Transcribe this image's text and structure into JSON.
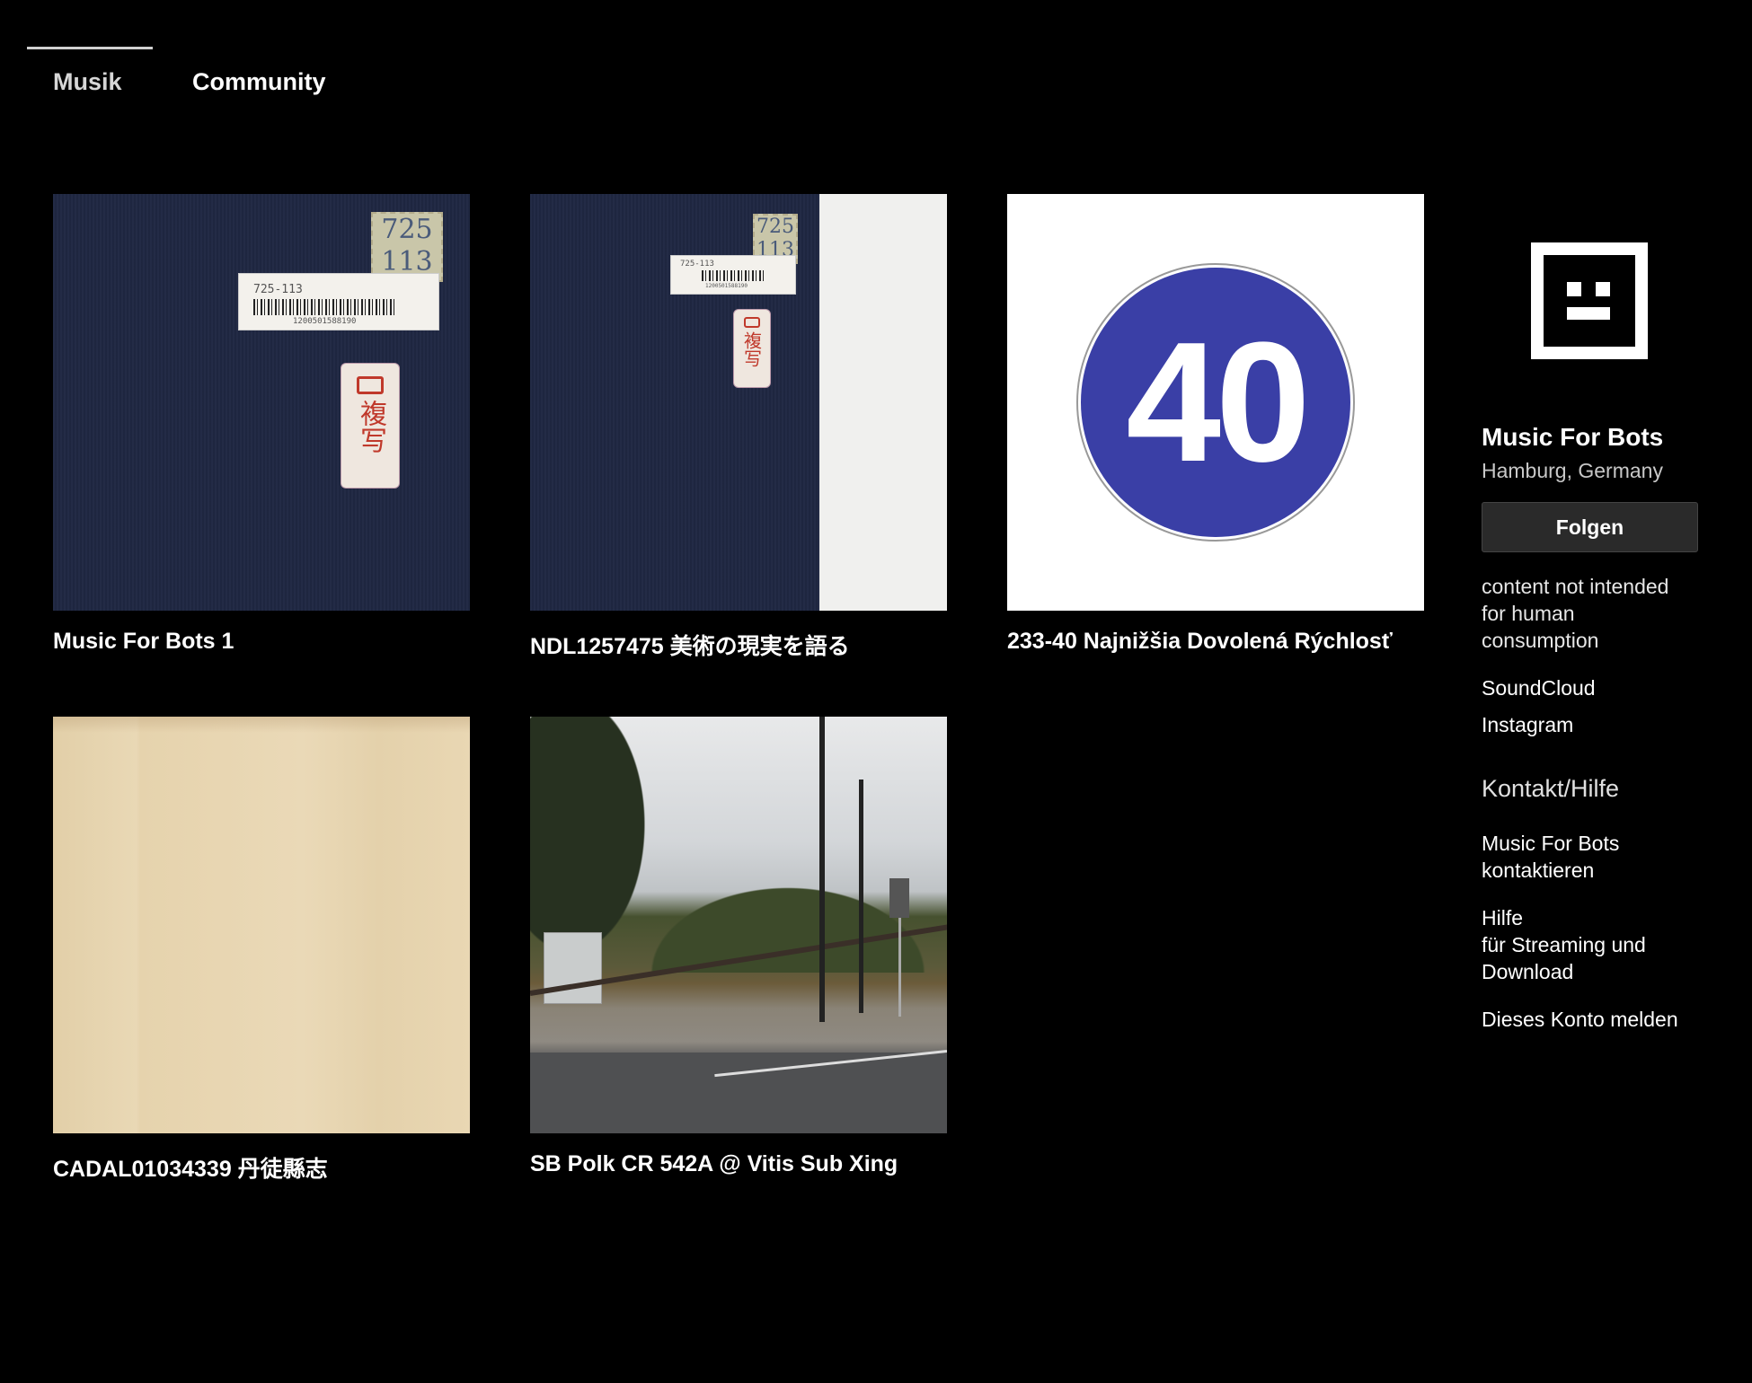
{
  "tabs": [
    {
      "label": "Musik",
      "active": true
    },
    {
      "label": "Community",
      "active": false
    }
  ],
  "releases": [
    {
      "title": "Music For Bots 1",
      "cover": "dark-blue-book-cover",
      "cover_text": {
        "stamp": "725\n113",
        "barcode_label": "725-113",
        "barcode_number": "1200501588190",
        "tag": "複写"
      }
    },
    {
      "title": "NDL1257475 美術の現実を語る",
      "cover": "dark-blue-book-with-page",
      "cover_text": {
        "stamp": "725\n113",
        "barcode_label": "725-113",
        "barcode_number": "1200501588190",
        "tag": "複写"
      }
    },
    {
      "title": "233-40 Najnižšia Dovolená Rýchlosť",
      "cover": "blue-speed-sign",
      "cover_text": {
        "sign": "40"
      }
    },
    {
      "title": "CADAL01034339 丹徒縣志",
      "cover": "beige-paper"
    },
    {
      "title": "SB Polk CR 542A @ Vitis Sub Xing",
      "cover": "railroad-crossing-photo"
    }
  ],
  "artist": {
    "name": "Music For Bots",
    "location": "Hamburg, Germany",
    "follow_label": "Folgen",
    "bio": "content not intended for human consumption",
    "links": [
      "SoundCloud",
      "Instagram"
    ]
  },
  "contact": {
    "heading": "Kontakt/Hilfe",
    "contact_artist": "Music For Bots kontaktieren",
    "help": "Hilfe\nfür Streaming und Download",
    "report": "Dieses Konto melden"
  },
  "colors": {
    "background": "#000000",
    "button_bg": "#2a2a2a",
    "sign_blue": "#3a3fa6"
  }
}
